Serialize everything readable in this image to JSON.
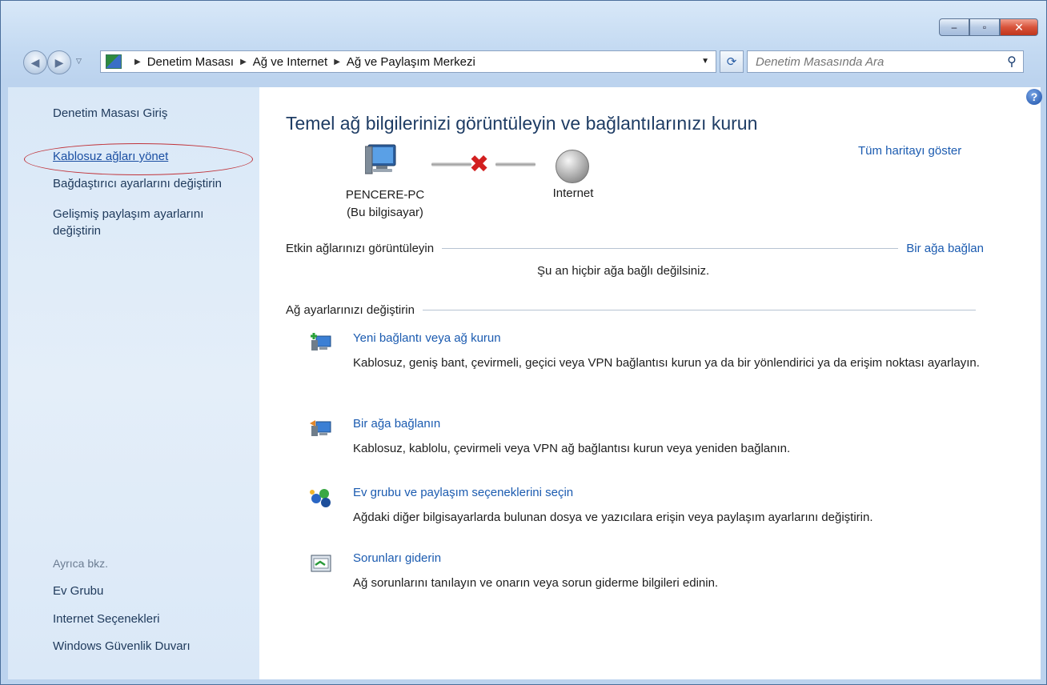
{
  "window": {
    "caption": {
      "minimize": "–",
      "maximize": "▫",
      "close": "✕"
    },
    "colors": {
      "link": "#1b5bb0",
      "title": "#1e3c64",
      "error_x": "#d21f1f",
      "highlight_oval": "#c0333a"
    }
  },
  "nav": {
    "breadcrumbs": [
      "Denetim Masası",
      "Ağ ve Internet",
      "Ağ ve Paylaşım Merkezi"
    ],
    "search_placeholder": "Denetim Masasında Ara",
    "icons": {
      "back": "back-arrow-icon",
      "forward": "forward-arrow-icon",
      "refresh": "refresh-icon",
      "search": "search-icon"
    }
  },
  "sidebar": {
    "home": "Denetim Masası Giriş",
    "links": [
      "Kablosuz ağları yönet",
      "Bağdaştırıcı ayarlarını değiştirin",
      "Gelişmiş paylaşım ayarlarını değiştirin"
    ],
    "see_also_label": "Ayrıca bkz.",
    "see_also": [
      "Ev Grubu",
      "Internet Seçenekleri",
      "Windows Güvenlik Duvarı"
    ]
  },
  "main": {
    "title": "Temel ağ bilgilerinizi görüntüleyin ve bağlantılarınızı kurun",
    "map_link": "Tüm haritayı göster",
    "computer": {
      "name": "PENCERE-PC",
      "sub": "(Bu bilgisayar)"
    },
    "internet": "Internet",
    "active_networks": {
      "heading": "Etkin ağlarınızı görüntüleyin",
      "connect_link": "Bir ağa bağlan",
      "status": "Şu an hiçbir ağa bağlı değilsiniz."
    },
    "change_settings": {
      "heading": "Ağ ayarlarınızı değiştirin",
      "tasks": [
        {
          "link": "Yeni bağlantı veya ağ kurun",
          "desc": "Kablosuz, geniş bant, çevirmeli, geçici veya VPN bağlantısı kurun ya da bir yönlendirici ya da erişim noktası ayarlayın.",
          "icon": "new-connection-icon"
        },
        {
          "link": "Bir ağa bağlanın",
          "desc": "Kablosuz, kablolu, çevirmeli veya VPN ağ bağlantısı kurun veya yeniden bağlanın.",
          "icon": "connect-network-icon"
        },
        {
          "link": "Ev grubu ve paylaşım seçeneklerini seçin",
          "desc": "Ağdaki diğer bilgisayarlarda bulunan dosya ve yazıcılara erişin veya paylaşım ayarlarını değiştirin.",
          "icon": "homegroup-icon"
        },
        {
          "link": "Sorunları giderin",
          "desc": "Ağ sorunlarını tanılayın ve onarın veya sorun giderme bilgileri edinin.",
          "icon": "troubleshoot-icon"
        }
      ]
    }
  }
}
